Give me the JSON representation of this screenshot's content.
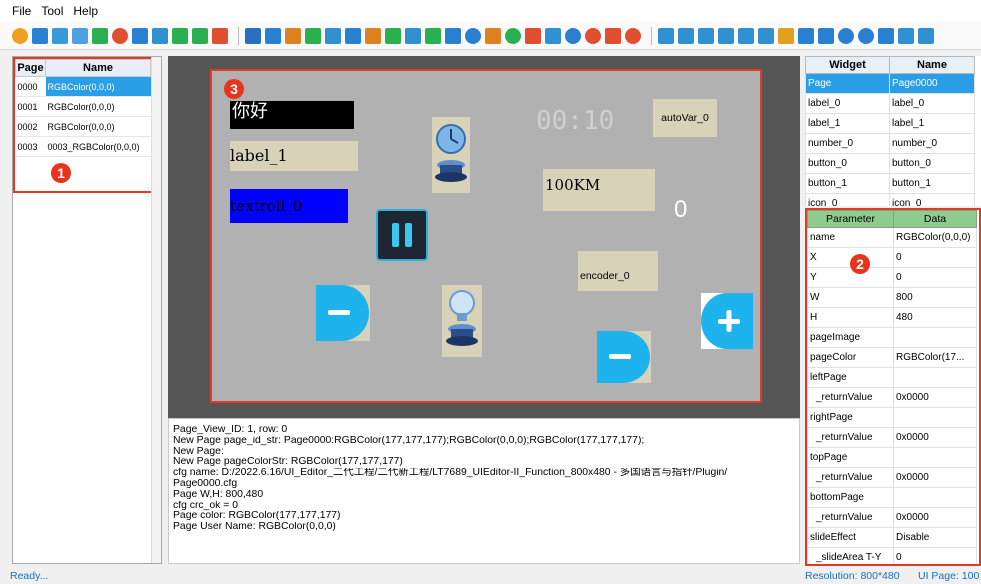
{
  "menu": {
    "file": "File",
    "tool": "Tool",
    "help": "Help"
  },
  "page_table": {
    "headers": [
      "Page",
      "Name"
    ],
    "rows": [
      {
        "page": "0000",
        "name": "RGBColor(0,0,0)"
      },
      {
        "page": "0001",
        "name": "RGBColor(0,0,0)"
      },
      {
        "page": "0002",
        "name": "RGBColor(0,0,0)"
      },
      {
        "page": "0003",
        "name": "0003_RGBColor(0,0,0)"
      }
    ]
  },
  "badges": {
    "b1": "1",
    "b2": "2",
    "b3": "3"
  },
  "canvas": {
    "label_hello": "你好",
    "label_1": "label_1",
    "textroll": "textroll_0",
    "time": "00:10",
    "autovar": "autoVar_0",
    "distance": "100KM",
    "number": "0",
    "encoder": "encoder_0"
  },
  "log_lines": [
    "Page_View_ID: 1, row: 0",
    "New Page page_id_str: Page0000:RGBColor(177,177,177);RGBColor(0,0,0);RGBColor(177,177,177);",
    "New Page:",
    "New Page pageColorStr: RGBColor(177,177,177)",
    "cfg name: D:/2022.6.16/UI_Editor_二代工程/二代新工程/LT7689_UIEditor-II_Function_800x480 - 多国语言与指针/Plugin/",
    "Page0000.cfg",
    "Page W,H: 800,480",
    "cfg crc_ok = 0",
    "Page color: RGBColor(177,177,177)",
    "Page User Name: RGBColor(0,0,0)"
  ],
  "widget_table": {
    "headers": [
      "Widget",
      "Name"
    ],
    "rows": [
      {
        "widget": "Page",
        "name": "Page0000"
      },
      {
        "widget": "label_0",
        "name": "label_0"
      },
      {
        "widget": "label_1",
        "name": "label_1"
      },
      {
        "widget": "number_0",
        "name": "number_0"
      },
      {
        "widget": "button_0",
        "name": "button_0"
      },
      {
        "widget": "button_1",
        "name": "button_1"
      },
      {
        "widget": "icon_0",
        "name": "icon_0"
      }
    ]
  },
  "param_table": {
    "headers": [
      "Parameter",
      "Data"
    ],
    "rows": [
      {
        "param": "name",
        "data": "RGBColor(0,0,0)"
      },
      {
        "param": "X",
        "data": "0"
      },
      {
        "param": "Y",
        "data": "0"
      },
      {
        "param": "W",
        "data": "800"
      },
      {
        "param": "H",
        "data": "480"
      },
      {
        "param": "pageImage",
        "data": ""
      },
      {
        "param": "pageColor",
        "data": "RGBColor(17..."
      },
      {
        "param": "leftPage",
        "data": ""
      },
      {
        "param": "_returnValue",
        "data": "0x0000"
      },
      {
        "param": "rightPage",
        "data": ""
      },
      {
        "param": "_returnValue",
        "data": "0x0000"
      },
      {
        "param": "topPage",
        "data": ""
      },
      {
        "param": "_returnValue",
        "data": "0x0000"
      },
      {
        "param": "bottomPage",
        "data": ""
      },
      {
        "param": "_returnValue",
        "data": "0x0000"
      },
      {
        "param": "slideEffect",
        "data": "Disable"
      },
      {
        "param": "_slideArea T-Y",
        "data": "0"
      }
    ]
  },
  "status": {
    "left": "Ready...",
    "resolution": "Resolution: 800*480",
    "uipage": "UI Page: 100"
  },
  "colors": {
    "accent": "#2b9ee8",
    "highlight_red": "#e03b24",
    "canvas_bg": "#b1b1b1",
    "param_header": "#8fca8f"
  }
}
